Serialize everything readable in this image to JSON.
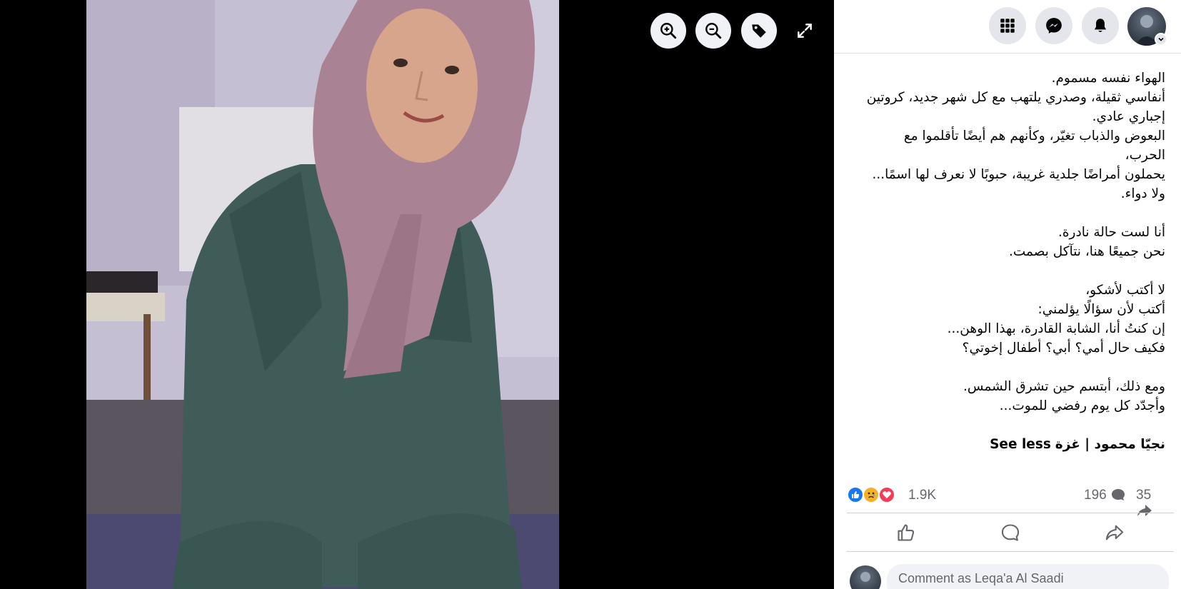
{
  "viewer": {
    "tools": {
      "zoom_in": "zoom-in-icon",
      "zoom_out": "zoom-out-icon",
      "tag": "tag-icon",
      "fullscreen": "fullscreen-icon"
    }
  },
  "topbar": {
    "menu": "menu-grid-icon",
    "messenger": "messenger-icon",
    "notifications": "bell-icon",
    "account": "account-avatar"
  },
  "post": {
    "lines": [
      "الهواء نفسه مسموم.",
      "أنفاسي ثقيلة، وصدري يلتهب مع كل شهر جديد، كروتين",
      "إجباري عادي.",
      "البعوض والذباب تغيّر، وكأنهم هم أيضًا تأقلموا مع",
      "الحرب،",
      "يحملون أمراضًا جلدية غريبة، حبوبًا لا نعرف لها اسمًا...",
      "ولا دواء.",
      "",
      "أنا لست حالة نادرة.",
      "نحن جميعًا هنا، نتآكل بصمت.",
      "",
      "لا أكتب لأشكو،",
      "أكتب لأن سؤالًا يؤلمني:",
      "إن كنتُ أنا، الشابة القادرة، بهذا الوهن...",
      "فكيف حال أمي؟ أبي؟ أطفال إخوتي؟",
      "",
      "ومع ذلك، أبتسم حين تشرق الشمس.",
      "وأجدّد كل يوم رفضي للموت..."
    ],
    "author": "نجيّا محمود | غزة",
    "see_less": "See less"
  },
  "stats": {
    "reactions": "1.9K",
    "comments": "196",
    "shares": "35"
  },
  "actions": {
    "like": "like-icon",
    "comment": "comment-icon",
    "share": "share-icon"
  },
  "comment": {
    "placeholder": "Comment as Leqa'a Al Saadi"
  },
  "colors": {
    "like_blue": "#1877f2",
    "love_red": "#f33e58",
    "sad_yellow": "#f7b125",
    "muted_text": "#65676b"
  }
}
